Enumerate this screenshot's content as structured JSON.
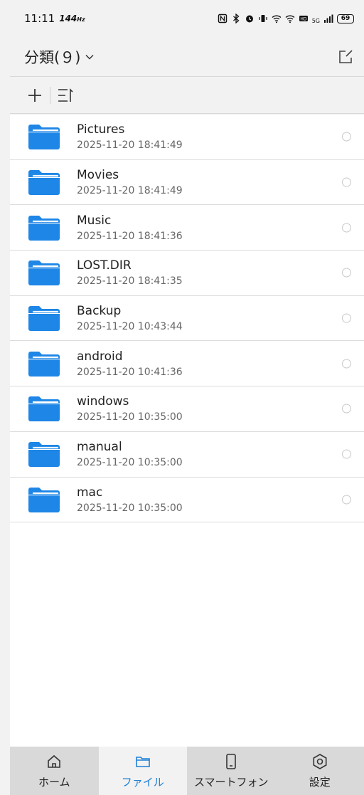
{
  "status_bar": {
    "time": "11:11",
    "refresh": "144",
    "hz": "Hz",
    "battery": "69",
    "signal": "5G"
  },
  "header": {
    "title": "分類(９)",
    "icons": [
      "chevron-down-icon",
      "edit-icon"
    ]
  },
  "toolbar": {
    "icons": [
      "plus-icon",
      "sort-icon"
    ]
  },
  "folders": [
    {
      "name": "Pictures",
      "date": "2025-11-20 18:41:49"
    },
    {
      "name": "Movies",
      "date": "2025-11-20 18:41:49"
    },
    {
      "name": "Music",
      "date": "2025-11-20 18:41:36"
    },
    {
      "name": "LOST.DIR",
      "date": "2025-11-20 18:41:35"
    },
    {
      "name": "Backup",
      "date": "2025-11-20 10:43:44"
    },
    {
      "name": "android",
      "date": "2025-11-20 10:41:36"
    },
    {
      "name": "windows",
      "date": "2025-11-20 10:35:00"
    },
    {
      "name": "manual",
      "date": "2025-11-20 10:35:00"
    },
    {
      "name": "mac",
      "date": "2025-11-20 10:35:00"
    }
  ],
  "nav": {
    "items": [
      {
        "label": "ホーム",
        "icon": "home-icon",
        "active": false
      },
      {
        "label": "ファイル",
        "icon": "folder-icon",
        "active": true
      },
      {
        "label": "スマートフォン",
        "icon": "phone-icon",
        "active": false
      },
      {
        "label": "設定",
        "icon": "settings-icon",
        "active": false
      }
    ]
  },
  "colors": {
    "accent": "#1e7fd6",
    "folder": "#1e86e6"
  }
}
